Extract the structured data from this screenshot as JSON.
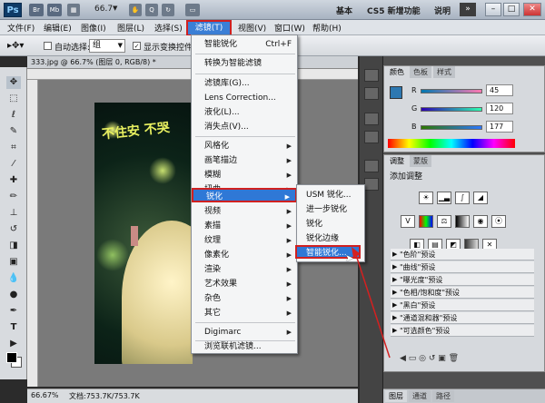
{
  "titlebar": {
    "logo": "Ps",
    "badges": [
      "Br",
      "Mb"
    ],
    "zoom": "66.7",
    "workspaces": [
      "基本",
      "CS5 新增功能",
      "说明"
    ],
    "more": "»"
  },
  "menubar": {
    "items": [
      "文件(F)",
      "编辑(E)",
      "图像(I)",
      "图层(L)",
      "选择(S)",
      "滤镜(T)",
      "视图(V)",
      "窗口(W)",
      "帮助(H)"
    ]
  },
  "options": {
    "auto_select_label": "自动选择:",
    "auto_select_value": "组",
    "show_transform_label": "显示变换控件"
  },
  "document": {
    "tab_title": "333.jpg @ 66.7% (图层 0, RGB/8) *",
    "close": "×",
    "art_text": "不住安 不哭",
    "status_zoom": "66.67%",
    "status_doc": "文档:753.7K/753.7K"
  },
  "filter_menu": {
    "items": [
      {
        "label": "智能锐化",
        "shortcut": "Ctrl+F"
      },
      {
        "label": "转换为智能滤镜"
      },
      {
        "label": "滤镜库(G)..."
      },
      {
        "label": "Lens Correction..."
      },
      {
        "label": "液化(L)..."
      },
      {
        "label": "消失点(V)..."
      },
      {
        "label": "风格化",
        "sub": true
      },
      {
        "label": "画笔描边",
        "sub": true
      },
      {
        "label": "模糊",
        "sub": true
      },
      {
        "label": "扭曲",
        "sub": true
      },
      {
        "label": "锐化",
        "sub": true,
        "active": true
      },
      {
        "label": "视频",
        "sub": true
      },
      {
        "label": "素描",
        "sub": true
      },
      {
        "label": "纹理",
        "sub": true
      },
      {
        "label": "像素化",
        "sub": true
      },
      {
        "label": "渲染",
        "sub": true
      },
      {
        "label": "艺术效果",
        "sub": true
      },
      {
        "label": "杂色",
        "sub": true
      },
      {
        "label": "其它",
        "sub": true
      },
      {
        "label": "Digimarc",
        "sub": true
      },
      {
        "label": "浏览联机滤镜..."
      }
    ],
    "arrow": "▶"
  },
  "sharpen_submenu": {
    "items": [
      "USM 锐化...",
      "进一步锐化",
      "锐化",
      "锐化边缘",
      "智能锐化..."
    ],
    "active_index": 4
  },
  "color_panel": {
    "tabs": [
      "颜色",
      "色板",
      "样式"
    ],
    "channels": [
      {
        "label": "R",
        "value": "45"
      },
      {
        "label": "G",
        "value": "120"
      },
      {
        "label": "B",
        "value": "177"
      }
    ],
    "swatch_color": "#2d78b1"
  },
  "adjust_panel": {
    "tabs": [
      "调整",
      "蒙版"
    ],
    "title": "添加调整",
    "presets": [
      "\"色阶\"预设",
      "\"曲线\"预设",
      "\"曝光度\"预设",
      "\"色相/饱和度\"预设",
      "\"黑白\"预设",
      "\"通道混和器\"预设",
      "\"可选颜色\"预设"
    ]
  },
  "layers_tabs": [
    "图层",
    "通道",
    "路径"
  ]
}
